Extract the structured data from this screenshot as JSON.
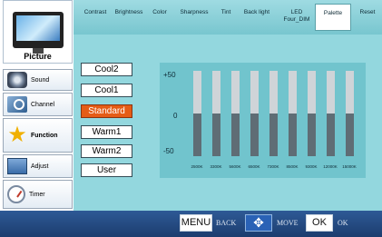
{
  "sidebar": {
    "items": [
      {
        "label": "Picture",
        "icon": "tv-icon"
      },
      {
        "label": "Sound",
        "icon": "speaker-icon"
      },
      {
        "label": "Channel",
        "icon": "channel-icon"
      },
      {
        "label": "Function",
        "icon": "star-icon"
      },
      {
        "label": "Adjust",
        "icon": "adjust-icon"
      },
      {
        "label": "Timer",
        "icon": "timer-icon"
      }
    ]
  },
  "tabs": [
    {
      "label": "Contrast"
    },
    {
      "label": "Brightness"
    },
    {
      "label": "Color"
    },
    {
      "label": "Sharpness"
    },
    {
      "label": "Tint"
    },
    {
      "label": "Back light"
    },
    {
      "label": "LED Four_DIM"
    },
    {
      "label": "Palette",
      "active": true
    },
    {
      "label": "Reset"
    }
  ],
  "presets": [
    {
      "label": "Cool2"
    },
    {
      "label": "Cool1"
    },
    {
      "label": "Standard",
      "selected": true
    },
    {
      "label": "Warm1"
    },
    {
      "label": "Warm2"
    },
    {
      "label": "User"
    }
  ],
  "chart": {
    "y_top": "+50",
    "y_mid": "0",
    "y_bottom": "-50"
  },
  "chart_data": {
    "type": "bar",
    "categories": [
      "2500K",
      "3300K",
      "5600K",
      "6500K",
      "7300K",
      "8500K",
      "9300K",
      "12000K",
      "15000K"
    ],
    "values": [
      0,
      0,
      0,
      0,
      0,
      0,
      0,
      0,
      0
    ],
    "ylim": [
      -50,
      50
    ]
  },
  "footer": {
    "menu_key": "MENU",
    "menu_label": "BACK",
    "move_key": "✥",
    "move_label": "MOVE",
    "ok_key": "OK",
    "ok_label": "OK"
  },
  "colors": {
    "tab_bg": "#8fd2da",
    "content_bg": "#93d7de",
    "chart_bg": "#71c4cd",
    "selected_preset": "#e55c16",
    "footer_bg": "#244a80"
  }
}
